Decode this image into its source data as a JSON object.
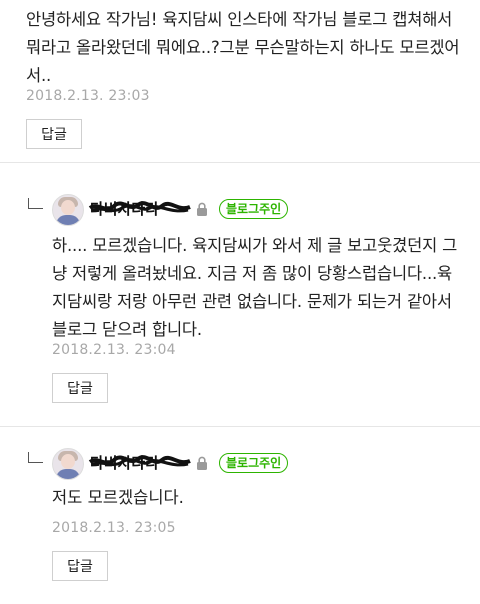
{
  "comments": [
    {
      "text": "안녕하세요 작가님! 육지담씨 인스타에 작가님 블로그 캡쳐해서 뭐라고 올라왔던데 뭐에요..?그분 무슨말하는지 하나도 모르겠어서..",
      "date": "2018.2.13. 23:03",
      "reply_label": "답글"
    }
  ],
  "replies": [
    {
      "author": "다비자다라",
      "badge": "블로그주인",
      "text": "하.... 모르겠습니다. 육지담씨가 와서 제 글 보고웃겼던지 그냥 저렇게 올려놨네요. 지금 저 좀 많이 당황스럽습니다...육지담씨랑 저랑 아무런 관련 없습니다. 문제가 되는거 같아서 블로그 닫으려 합니다.",
      "date": "2018.2.13. 23:04",
      "reply_label": "답글"
    },
    {
      "author": "다비자다라",
      "badge": "블로그주인",
      "text": "저도 모르겠습니다.",
      "date": "2018.2.13. 23:05",
      "reply_label": "답글"
    }
  ],
  "icons": {
    "reply_arrow": "reply-arrow-icon",
    "lock": "lock-icon"
  },
  "colors": {
    "owner_badge": "#2db400",
    "date": "#a8a8a8"
  }
}
